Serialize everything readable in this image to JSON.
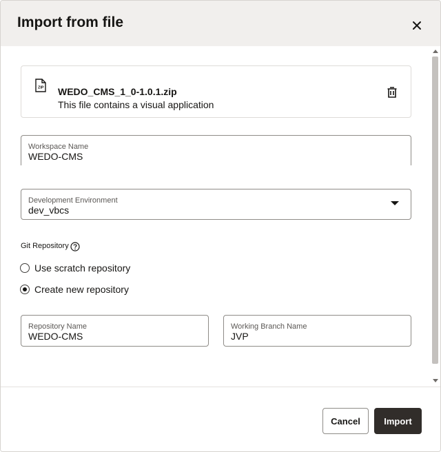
{
  "dialog": {
    "title": "Import from file",
    "close_icon": "close-icon"
  },
  "file": {
    "icon": "zip-file-icon",
    "icon_text": "ZIP",
    "name": "WEDO_CMS_1_0-1.0.1.zip",
    "description": "This file contains a visual application",
    "delete_icon": "trash-icon"
  },
  "workspace": {
    "label": "Workspace Name",
    "value": "WEDO-CMS"
  },
  "dev_env": {
    "label": "Development Environment",
    "value": "dev_vbcs",
    "icon": "chevron-down-icon"
  },
  "git": {
    "label": "Git Repository",
    "help_icon": "help-icon",
    "options": [
      {
        "label": "Use scratch repository",
        "selected": false
      },
      {
        "label": "Create new repository",
        "selected": true
      }
    ]
  },
  "repo": {
    "label": "Repository Name",
    "value": "WEDO-CMS"
  },
  "branch": {
    "label": "Working Branch Name",
    "value": "JVP"
  },
  "footer": {
    "cancel_label": "Cancel",
    "import_label": "Import"
  },
  "colors": {
    "header_bg": "#f1efed",
    "primary_button": "#312d2a",
    "border": "#8e8b87"
  }
}
